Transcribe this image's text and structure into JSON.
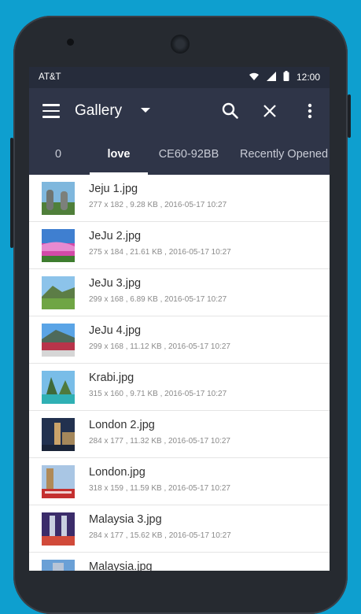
{
  "status": {
    "carrier": "AT&T",
    "time": "12:00"
  },
  "toolbar": {
    "title": "Gallery"
  },
  "tabs": [
    {
      "label": "0"
    },
    {
      "label": "love",
      "active": true
    },
    {
      "label": "CE60-92BB"
    },
    {
      "label": "Recently Opened"
    }
  ],
  "files": [
    {
      "name": "Jeju 1.jpg",
      "meta": "277 x 182 , 9.28 KB , 2016-05-17 10:27"
    },
    {
      "name": "JeJu 2.jpg",
      "meta": "275 x 184 , 21.61 KB , 2016-05-17 10:27"
    },
    {
      "name": "JeJu 3.jpg",
      "meta": "299 x 168 , 6.89 KB , 2016-05-17 10:27"
    },
    {
      "name": "JeJu 4.jpg",
      "meta": "299 x 168 , 11.12 KB , 2016-05-17 10:27"
    },
    {
      "name": "Krabi.jpg",
      "meta": "315 x 160 , 9.71 KB , 2016-05-17 10:27"
    },
    {
      "name": "London 2.jpg",
      "meta": "284 x 177 , 11.32 KB , 2016-05-17 10:27"
    },
    {
      "name": "London.jpg",
      "meta": "318 x 159 , 11.59 KB , 2016-05-17 10:27"
    },
    {
      "name": "Malaysia 3.jpg",
      "meta": "284 x 177 , 15.62 KB , 2016-05-17 10:27"
    },
    {
      "name": "Malaysia.jpg",
      "meta": ""
    }
  ],
  "colors": {
    "background": "#0e9fcf",
    "statusbar": "#262c3b",
    "toolbar": "#2f3548"
  },
  "icons": [
    "menu-icon",
    "dropdown-arrow-icon",
    "search-icon",
    "close-icon",
    "more-vert-icon",
    "wifi-icon",
    "signal-icon",
    "battery-icon"
  ]
}
